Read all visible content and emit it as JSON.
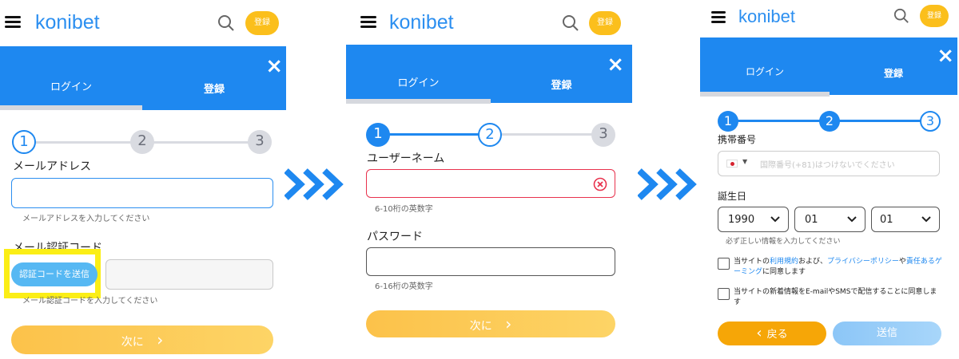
{
  "brand": {
    "logo": "konibet",
    "register_pill": "登録"
  },
  "colors": {
    "accent": "#1e88f0",
    "yellow": "#fbbf1c",
    "error": "#e8324d"
  },
  "tabs": {
    "login": "ログイン",
    "register": "登録"
  },
  "icons": {
    "close": "×",
    "search": "search-icon",
    "chevron_right": "›",
    "chevron_left": "‹"
  },
  "panel1": {
    "steps": [
      "1",
      "2",
      "3"
    ],
    "email_label": "メールアドレス",
    "email_value": "",
    "email_hint": "メールアドレスを入力してください",
    "code_label": "メール認証コード",
    "send_code_button": "認証コードを送信",
    "code_value": "",
    "code_hint": "メール認証コードを入力してください",
    "next_button": "次に"
  },
  "panel2": {
    "steps": [
      "1",
      "2",
      "3"
    ],
    "username_label": "ユーザーネーム",
    "username_hint": "6-10桁の英数字",
    "password_label": "パスワード",
    "password_hint": "6-16桁の英数字",
    "next_button": "次に"
  },
  "panel3": {
    "steps": [
      "1",
      "2",
      "3"
    ],
    "phone_label": "携帯番号",
    "phone_placeholder": "国際番号(+81)はつけないでください",
    "birthday_label": "誕生日",
    "year": "1990",
    "month": "01",
    "day": "01",
    "birthday_hint": "必ず正しい情報を入力してください",
    "terms_1": "当サイトの",
    "terms_link1": "利用規約",
    "terms_2": "および、",
    "terms_link2": "プライバシーポリシー",
    "terms_3": "や",
    "terms_link3": "責任あるゲーミング",
    "terms_4": "に同意します",
    "newsletter": "当サイトの新着情報をE-mailやSMSで配信することに同意します",
    "back_button": "戻る",
    "submit_button": "送信"
  }
}
